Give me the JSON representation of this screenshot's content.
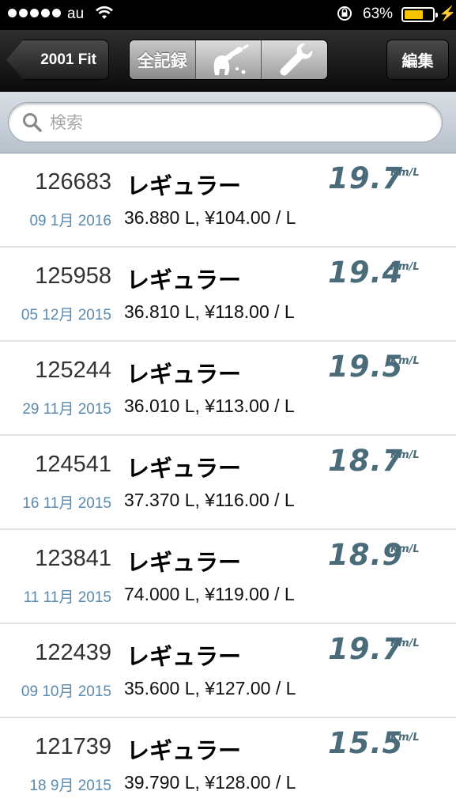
{
  "status_bar": {
    "carrier": "au",
    "battery_percent": "63%",
    "battery_level": 0.63,
    "battery_color": "#f5c400",
    "icons": [
      "signal-dots-icon",
      "wifi-icon",
      "rotation-lock-icon",
      "battery-icon",
      "charging-bolt-icon"
    ]
  },
  "nav": {
    "back_label": "2001 Fit",
    "segments": [
      {
        "label": "全記録",
        "icon": null
      },
      {
        "label": "",
        "icon": "fuel-pump-icon"
      },
      {
        "label": "",
        "icon": "wrench-icon"
      }
    ],
    "edit_label": "編集"
  },
  "search": {
    "placeholder": "検索",
    "value": ""
  },
  "records": [
    {
      "odometer": "126683",
      "date": "09 1月 2016",
      "grade": "レギュラー",
      "detail": "36.880 L, ¥104.00 / L",
      "efficiency": "19.7",
      "unit": "Km/L"
    },
    {
      "odometer": "125958",
      "date": "05 12月 2015",
      "grade": "レギュラー",
      "detail": "36.810 L, ¥118.00 / L",
      "efficiency": "19.4",
      "unit": "Km/L"
    },
    {
      "odometer": "125244",
      "date": "29 11月 2015",
      "grade": "レギュラー",
      "detail": "36.010 L, ¥113.00 / L",
      "efficiency": "19.5",
      "unit": "Km/L"
    },
    {
      "odometer": "124541",
      "date": "16 11月 2015",
      "grade": "レギュラー",
      "detail": "37.370 L, ¥116.00 / L",
      "efficiency": "18.7",
      "unit": "Km/L"
    },
    {
      "odometer": "123841",
      "date": "11 11月 2015",
      "grade": "レギュラー",
      "detail": "74.000 L, ¥119.00 / L",
      "efficiency": "18.9",
      "unit": "Km/L"
    },
    {
      "odometer": "122439",
      "date": "09 10月 2015",
      "grade": "レギュラー",
      "detail": "35.600 L, ¥127.00 / L",
      "efficiency": "19.7",
      "unit": "Km/L"
    },
    {
      "odometer": "121739",
      "date": "18 9月 2015",
      "grade": "レギュラー",
      "detail": "39.790 L, ¥128.00 / L",
      "efficiency": "15.5",
      "unit": "Km/L"
    }
  ]
}
